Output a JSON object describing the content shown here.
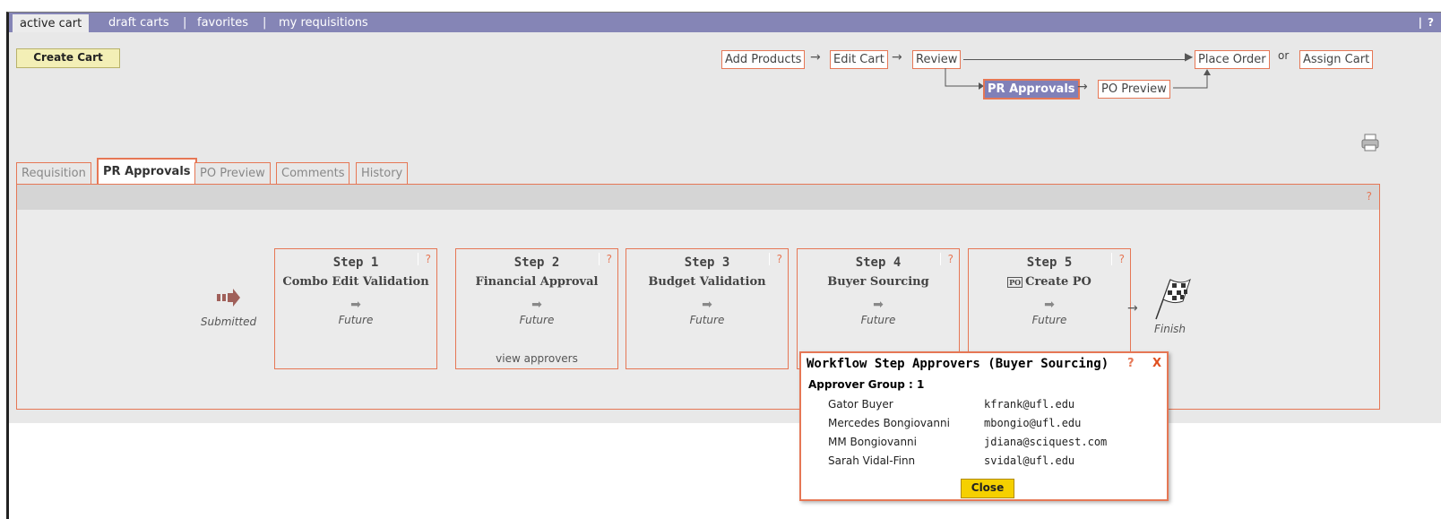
{
  "topnav": {
    "active_tab": "active cart",
    "tabs": [
      "draft carts",
      "favorites",
      "my requisitions"
    ],
    "separator": "|",
    "help": "?"
  },
  "toolbar": {
    "create_cart": "Create Cart"
  },
  "process": {
    "add_products": "Add Products",
    "edit_cart": "Edit Cart",
    "review": "Review",
    "place_order": "Place Order",
    "or": "or",
    "assign_cart": "Assign Cart",
    "pr_approvals": "PR Approvals",
    "po_preview": "PO Preview"
  },
  "view_tabs": {
    "requisition": "Requisition",
    "pr_approvals": "PR Approvals",
    "po_preview": "PO Preview",
    "comments": "Comments",
    "history": "History"
  },
  "panel": {
    "help": "?"
  },
  "workflow": {
    "submitted": "Submitted",
    "finish": "Finish",
    "steps": [
      {
        "title": "Step 1",
        "name": "Combo Edit Validation",
        "status": "Future",
        "help": "?",
        "link": ""
      },
      {
        "title": "Step 2",
        "name": "Financial Approval",
        "status": "Future",
        "help": "?",
        "link": "view approvers"
      },
      {
        "title": "Step 3",
        "name": "Budget Validation",
        "status": "Future",
        "help": "?",
        "link": ""
      },
      {
        "title": "Step 4",
        "name": "Buyer Sourcing",
        "status": "Future",
        "help": "?",
        "link": ""
      },
      {
        "title": "Step 5",
        "name": "Create PO",
        "status": "Future",
        "help": "?",
        "link": "",
        "icon": "PO"
      }
    ]
  },
  "popup": {
    "title": "Workflow Step Approvers (Buyer Sourcing)",
    "help": "?",
    "close_x": "X",
    "group": "Approver Group : 1",
    "approvers": [
      {
        "name": "Gator Buyer",
        "email": "kfrank@ufl.edu"
      },
      {
        "name": "Mercedes Bongiovanni",
        "email": "mbongio@ufl.edu"
      },
      {
        "name": "MM Bongiovanni",
        "email": "jdiana@sciquest.com"
      },
      {
        "name": "Sarah Vidal-Finn",
        "email": "svidal@ufl.edu"
      }
    ],
    "close_button": "Close"
  },
  "colors": {
    "topbar": "#8585b6",
    "accent_border": "#e67755",
    "active_step": "#8080b8",
    "close_button": "#f5d000"
  }
}
